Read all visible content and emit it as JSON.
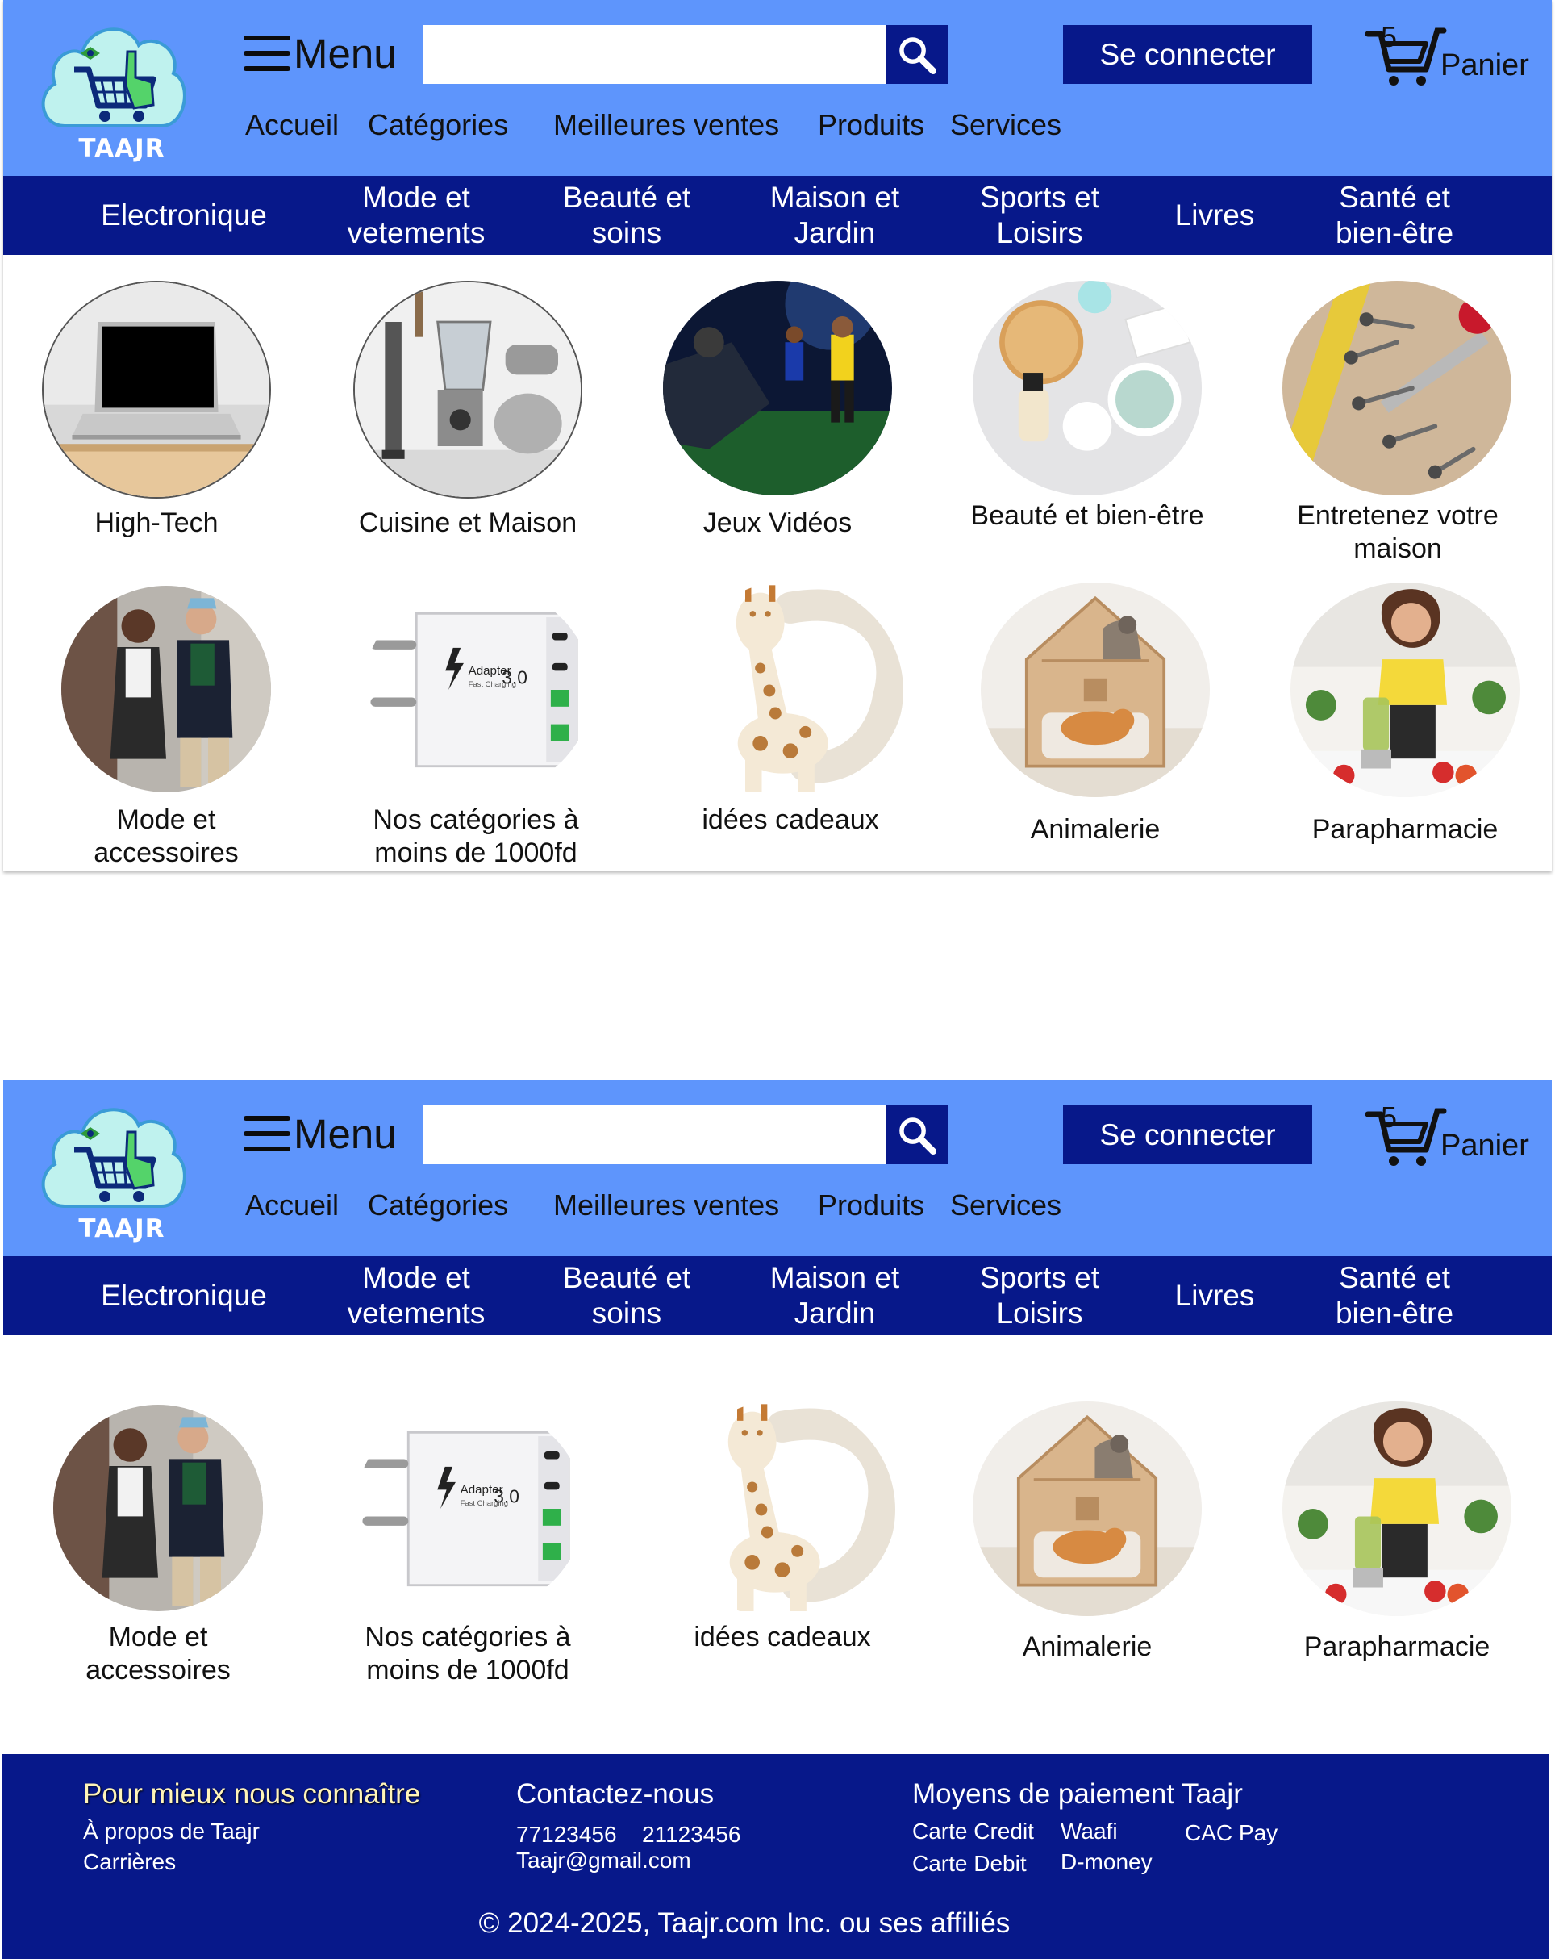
{
  "brand": {
    "name": "TAAJR"
  },
  "header": {
    "menu_label": "Menu",
    "search_placeholder": "",
    "signin_label": "Se connecter",
    "cart_count": "5",
    "cart_label": "Panier"
  },
  "topnav": [
    "Accueil",
    "Catégories",
    "Meilleures ventes",
    "Produits",
    "Services"
  ],
  "categories_bar": [
    "Electronique",
    "Mode et vetements",
    "Beauté et soins",
    "Maison et Jardin",
    "Sports et Loisirs",
    "Livres",
    "Santé et bien-être"
  ],
  "grid_row1": [
    {
      "label": "High-Tech",
      "icon": "laptop-image"
    },
    {
      "label": "Cuisine et Maison",
      "icon": "blender-image"
    },
    {
      "label": "Jeux Vidéos",
      "icon": "video-game-image"
    },
    {
      "label": "Beauté et bien-être",
      "icon": "cosmetics-image"
    },
    {
      "label": "Entretenez votre maison",
      "icon": "tools-image"
    }
  ],
  "grid_row2": [
    {
      "label": "Mode et accessoires",
      "icon": "fashion-couple-image"
    },
    {
      "label": "Nos catégories à moins de 1000fd",
      "icon": "charger-image"
    },
    {
      "label": "idées cadeaux",
      "icon": "giraffe-toy-image"
    },
    {
      "label": "Animalerie",
      "icon": "cat-house-image"
    },
    {
      "label": "Parapharmacie",
      "icon": "smoothie-woman-image"
    }
  ],
  "charger_text": {
    "brand": "Adapter",
    "version": "3.0",
    "sub": "Fast Charging"
  },
  "footer": {
    "about": {
      "title": "Pour mieux nous connaître",
      "links": [
        "À propos de Taajr",
        "Carrières"
      ]
    },
    "contact": {
      "title": "Contactez-nous",
      "phone1": "77123456",
      "phone2": "21123456",
      "email": "Taajr@gmail.com"
    },
    "payment": {
      "title": "Moyens de paiement Taajr",
      "methods": [
        "Carte Credit",
        "Waafi",
        "CAC Pay",
        "Carte Debit",
        "D-money"
      ]
    },
    "copyright": "© 2024-2025, Taajr.com Inc. ou ses affiliés"
  },
  "colors": {
    "header_bg": "#5e95fc",
    "navy": "#07188a",
    "white": "#ffffff"
  }
}
